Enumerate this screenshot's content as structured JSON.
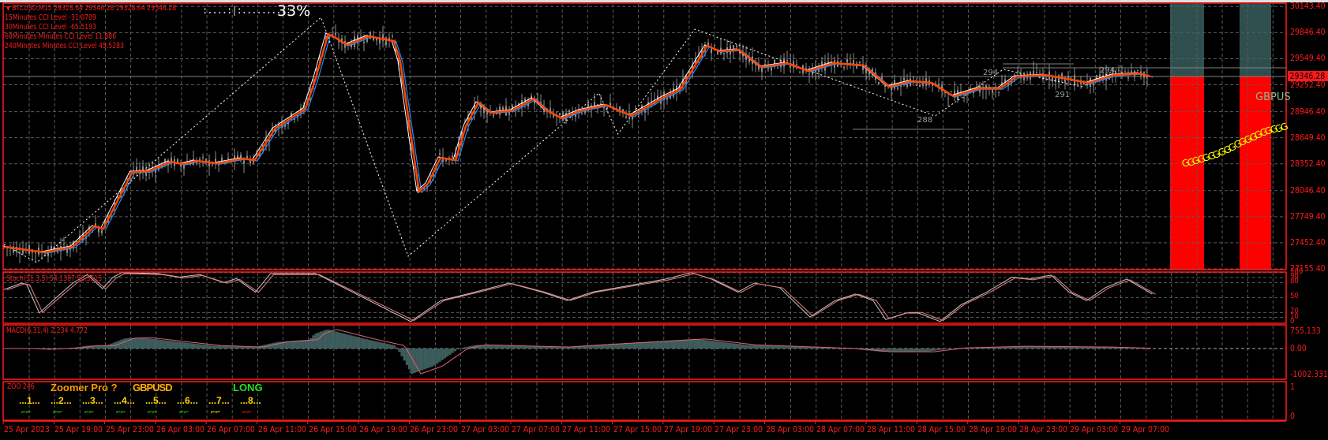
{
  "header": {
    "symbol_line": "BTCUSD,M15  29328.64 29346.28 29328.64 29346.28",
    "cci_lines": [
      "15Minutes CCI Level -31.0709",
      "30Minutes CCI Level -65.5193",
      "60Minutes Minutes CCI Level 11.886",
      "240Minutes Minutes CCI Level 45.5283"
    ],
    "progress_dots": ":....:|:.........:",
    "progress_percent": "33%",
    "progress_value": 33
  },
  "price_axis": {
    "labels": [
      "30143.40",
      "29846.40",
      "29549.40",
      "29252.40",
      "28946.40",
      "28649.40",
      "28352.40",
      "28046.40",
      "27749.40",
      "27452.40",
      "27155.40"
    ],
    "current_price": "29346.28"
  },
  "stoch": {
    "label": "Stoch(31,3,5) 54.1387 56.3515",
    "levels": [
      "100",
      "90",
      "80",
      "50",
      "20",
      "10",
      "0"
    ]
  },
  "macd": {
    "label": "MACD(6,31,4) 2.234 4.772",
    "levels": [
      "755.133",
      "0.00",
      "-1002.331"
    ]
  },
  "zoomer": {
    "id_label": "ZOO 246",
    "title": "Zoomer Pro ?",
    "pair": "GBPUSD",
    "signal": "LONG",
    "slots": [
      "...1...",
      "...2...",
      "...3...",
      "...4...",
      "...5...",
      "...6...",
      "...7...",
      "...8..."
    ],
    "slot_arrows": [
      "⌐⌐",
      "⌐⌐",
      "⌐⌐",
      "⌐⌐",
      "⌐⌐",
      "⌐⌐",
      "⌐⌐",
      "⌐⌐"
    ],
    "slot_colors": [
      "#22e022",
      "#22e022",
      "#22e022",
      "#22e022",
      "#22e022",
      "#22e022",
      "#ffff00",
      "#ff1a1a"
    ],
    "levels": [
      "1",
      "0"
    ]
  },
  "overlay": {
    "gbpus_label": "GBPUS",
    "g_chain": "GGGGGGGGGGGGGGGGGGGG",
    "level_labels": [
      "288",
      "291",
      "294",
      "294"
    ]
  },
  "time_axis": {
    "labels": [
      "25 Apr 2023",
      "25 Apr 19:00",
      "25 Apr 23:00",
      "26 Apr 03:00",
      "26 Apr 07:00",
      "26 Apr 11:00",
      "26 Apr 15:00",
      "26 Apr 19:00",
      "26 Apr 23:00",
      "27 Apr 03:00",
      "27 Apr 07:00",
      "27 Apr 11:00",
      "27 Apr 15:00",
      "27 Apr 19:00",
      "27 Apr 23:00",
      "28 Apr 03:00",
      "28 Apr 07:00",
      "28 Apr 11:00",
      "28 Apr 15:00",
      "28 Apr 19:00",
      "28 Apr 23:00",
      "29 Apr 03:00",
      "29 Apr 07:00"
    ]
  },
  "colors": {
    "frame": "#ff1a1a",
    "ma_fast": "#ff4500",
    "ma_slow": "#1e90ff",
    "candle": "#8c8c8c",
    "teal_zone": "#2f4f4f",
    "red_zone": "#ff0000"
  },
  "chart_data": {
    "type": "line",
    "title": "BTCUSD,M15",
    "x_unit": "hours from chart start",
    "ylim": [
      27155.4,
      30143.4
    ],
    "moving_average": {
      "x": [
        0,
        3.1,
        5.4,
        7.1,
        7.8,
        10.1,
        11.4,
        13.1,
        14.1,
        15.1,
        16.8,
        18.8,
        19.8,
        21.4,
        23.8,
        24.6,
        25.6,
        26.1,
        27.1,
        28.8,
        30.8,
        31.3,
        32.8,
        33.5,
        34.5,
        35.7,
        36.5,
        37.5,
        38.5,
        40.2,
        41.9,
        42.9,
        44.1,
        45.6,
        47.6,
        49.6,
        52.2,
        53.5,
        55.6,
        56.6,
        58.1,
        59.9,
        61.9,
        63.6,
        65.6,
        68,
        70,
        71.7,
        73.4,
        75.1,
        77.1,
        78.8,
        80.1,
        82.4,
        85.8,
        87.8,
        89.8,
        90.7
      ],
      "y": [
        27407,
        27344,
        27407,
        27640,
        27613,
        28259,
        28268,
        28376,
        28349,
        28385,
        28358,
        28412,
        28394,
        28753,
        28978,
        29319,
        29831,
        29796,
        29706,
        29805,
        29751,
        29526,
        28035,
        28125,
        28421,
        28394,
        28781,
        29050,
        28933,
        28961,
        29095,
        28961,
        28871,
        28961,
        29023,
        28898,
        29113,
        29203,
        29697,
        29634,
        29652,
        29454,
        29499,
        29409,
        29499,
        29472,
        29230,
        29292,
        29274,
        29122,
        29211,
        29211,
        29346,
        29364,
        29274,
        29364,
        29382,
        29346
      ]
    },
    "zigzag": {
      "x": [
        0,
        2.6,
        25.1,
        32,
        47.1,
        48.6,
        54.7,
        73.7,
        79.1,
        85.3,
        88.1
      ],
      "y": [
        27435,
        27228,
        30020,
        27299,
        29158,
        28691,
        29885,
        28897,
        29427,
        29230,
        29427
      ]
    },
    "stochastic": {
      "x": [
        0,
        1.4,
        1.8,
        2.8,
        4.1,
        5.5,
        6.6,
        7.8,
        8.6,
        9.3,
        12.2,
        13.9,
        15.5,
        17.4,
        18.4,
        19.9,
        21.1,
        24.7,
        32.2,
        34.6,
        37.3,
        40,
        42.6,
        44.6,
        46.6,
        50.6,
        52.4,
        54.4,
        56,
        58.1,
        59.4,
        61.4,
        63.8,
        65.8,
        67.4,
        68.8,
        69.8,
        71.4,
        72.4,
        74.1,
        75.8,
        77.8,
        79.8,
        81.2,
        82.9,
        84.3,
        85.7,
        87.2,
        88.9,
        90.9
      ],
      "y": [
        66,
        79,
        76,
        19,
        49,
        80,
        96,
        68,
        90,
        100,
        98,
        91,
        96,
        80,
        88,
        61,
        98,
        98,
        2,
        44,
        61,
        79,
        61,
        44,
        61,
        79,
        87,
        100,
        87,
        61,
        79,
        70,
        11,
        44,
        57,
        44,
        6,
        19,
        19,
        2,
        36,
        61,
        91,
        87,
        95,
        61,
        44,
        70,
        87,
        57
      ],
      "range": [
        0,
        100
      ]
    },
    "macd_histogram": {
      "x": [
        0,
        1.8,
        2.8,
        5.3,
        6.6,
        8,
        9.5,
        10.8,
        13.3,
        16.4,
        19.7,
        21.6,
        24.1,
        24.5,
        25.5,
        28.5,
        30.9,
        32.2,
        33.9,
        35.9,
        37.3,
        44,
        46.6,
        54.7,
        58.7,
        66.8,
        69.4,
        72.8,
        75.4,
        80.2,
        86.9,
        90.9
      ],
      "y": [
        0,
        0,
        -30,
        30,
        130,
        130,
        450,
        480,
        320,
        130,
        65,
        290,
        390,
        640,
        840,
        420,
        130,
        -1000,
        -700,
        0,
        160,
        65,
        160,
        420,
        160,
        0,
        -130,
        -130,
        30,
        100,
        65,
        0
      ],
      "ylim": [
        -1002.331,
        755.133
      ]
    }
  }
}
